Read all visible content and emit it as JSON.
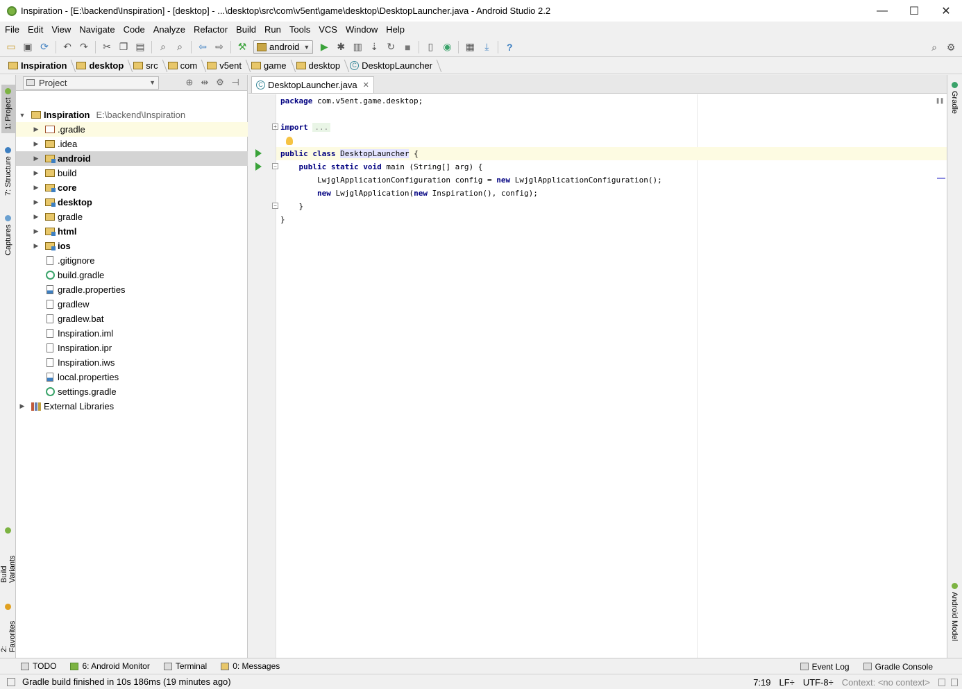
{
  "window": {
    "title": "Inspiration - [E:\\backend\\Inspiration] - [desktop] - ...\\desktop\\src\\com\\v5ent\\game\\desktop\\DesktopLauncher.java - Android Studio 2.2",
    "minimize": "—",
    "maximize": "☐",
    "close": "✕"
  },
  "menu": [
    "File",
    "Edit",
    "View",
    "Navigate",
    "Code",
    "Analyze",
    "Refactor",
    "Build",
    "Run",
    "Tools",
    "VCS",
    "Window",
    "Help"
  ],
  "toolbar": {
    "run_config": "android"
  },
  "breadcrumb": [
    "Inspiration",
    "desktop",
    "src",
    "com",
    "v5ent",
    "game",
    "desktop",
    "DesktopLauncher"
  ],
  "left_tabs": [
    "1: Project",
    "7: Structure",
    "Captures",
    "Build Variants",
    "2: Favorites"
  ],
  "right_tabs": [
    "Gradle",
    "Android Model"
  ],
  "project_panel": {
    "view_label": "Project",
    "root": {
      "name": "Inspiration",
      "path": "E:\\backend\\Inspiration"
    },
    "items": [
      {
        "name": ".gradle",
        "kind": "folder-excluded",
        "expandable": true,
        "bold": false
      },
      {
        "name": ".idea",
        "kind": "folder",
        "expandable": true,
        "bold": false
      },
      {
        "name": "android",
        "kind": "module",
        "expandable": true,
        "bold": true
      },
      {
        "name": "build",
        "kind": "folder",
        "expandable": true,
        "bold": false
      },
      {
        "name": "core",
        "kind": "module",
        "expandable": true,
        "bold": true
      },
      {
        "name": "desktop",
        "kind": "module",
        "expandable": true,
        "bold": true
      },
      {
        "name": "gradle",
        "kind": "folder",
        "expandable": true,
        "bold": false
      },
      {
        "name": "html",
        "kind": "module",
        "expandable": true,
        "bold": true
      },
      {
        "name": "ios",
        "kind": "module",
        "expandable": true,
        "bold": true
      },
      {
        "name": ".gitignore",
        "kind": "file",
        "expandable": false,
        "bold": false
      },
      {
        "name": "build.gradle",
        "kind": "gradle",
        "expandable": false,
        "bold": false
      },
      {
        "name": "gradle.properties",
        "kind": "props",
        "expandable": false,
        "bold": false
      },
      {
        "name": "gradlew",
        "kind": "file",
        "expandable": false,
        "bold": false
      },
      {
        "name": "gradlew.bat",
        "kind": "file",
        "expandable": false,
        "bold": false
      },
      {
        "name": "Inspiration.iml",
        "kind": "file",
        "expandable": false,
        "bold": false
      },
      {
        "name": "Inspiration.ipr",
        "kind": "file",
        "expandable": false,
        "bold": false
      },
      {
        "name": "Inspiration.iws",
        "kind": "file",
        "expandable": false,
        "bold": false
      },
      {
        "name": "local.properties",
        "kind": "props",
        "expandable": false,
        "bold": false
      },
      {
        "name": "settings.gradle",
        "kind": "gradle",
        "expandable": false,
        "bold": false
      }
    ],
    "external": "External Libraries"
  },
  "editor": {
    "tab": "DesktopLauncher.java",
    "code": {
      "l1_kw": "package",
      "l1_rest": " com.v5ent.game.desktop;",
      "l3_kw": "import",
      "l3_fold": "...",
      "l6_kw": "public class",
      "l6_cls": "DesktopLauncher",
      "l6_rest": " {",
      "l7_kw": "public static void",
      "l7_rest": " main (String[] arg) {",
      "l8_a": "LwjglApplicationConfiguration config = ",
      "l8_kw": "new",
      "l8_b": " LwjglApplicationConfiguration();",
      "l9_kw1": "new",
      "l9_a": " LwjglApplication(",
      "l9_kw2": "new",
      "l9_b": " Inspiration(), config);",
      "l10": "}",
      "l11": "}"
    }
  },
  "bottom_tools": {
    "todo": "TODO",
    "android_monitor": "6: Android Monitor",
    "terminal": "Terminal",
    "messages": "0: Messages",
    "event_log": "Event Log",
    "gradle_console": "Gradle Console"
  },
  "status": {
    "message": "Gradle build finished in 10s 186ms (19 minutes ago)",
    "position": "7:19",
    "line_sep": "LF÷",
    "encoding": "UTF-8÷",
    "context": "Context: <no context>"
  }
}
